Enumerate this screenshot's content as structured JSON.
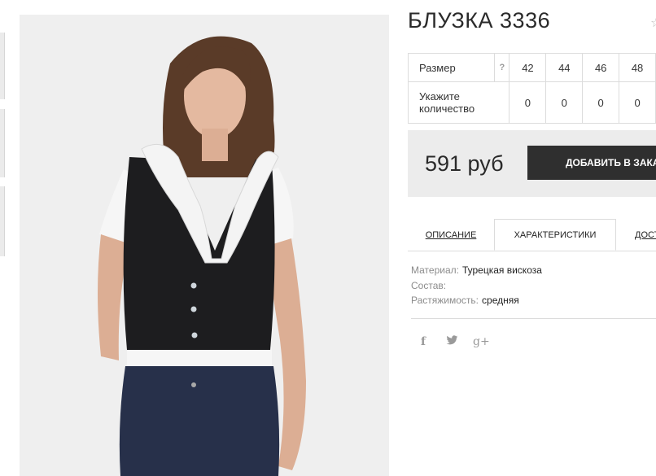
{
  "product": {
    "title": "БЛУЗКА 3336"
  },
  "sizes": {
    "row_label": "Размер",
    "help": "?",
    "values": [
      "42",
      "44",
      "46",
      "48"
    ],
    "qty_label": "Укажите количество",
    "quantities": [
      "0",
      "0",
      "0",
      "0"
    ]
  },
  "price": {
    "amount": "591 руб",
    "cart_label": "ДОБАВИТЬ В ЗАКАЗ"
  },
  "tabs": [
    {
      "label": "ОПИСАНИЕ"
    },
    {
      "label": "ХАРАКТЕРИСТИКИ"
    },
    {
      "label": "ДОСТАВКА"
    }
  ],
  "characteristics": [
    {
      "key": "Материал:",
      "value": "Турецкая вискоза"
    },
    {
      "key": "Состав:",
      "value": ""
    },
    {
      "key": "Растяжимость:",
      "value": "средняя"
    }
  ],
  "social": {
    "facebook": "f",
    "twitter": "🐦",
    "googleplus": "g+"
  },
  "icons": [
    "star-icon",
    "shopping-bag-icon",
    "facebook-icon",
    "twitter-icon",
    "google-plus-icon"
  ],
  "colors": {
    "button_bg": "#2f2f2f",
    "price_box_bg": "#ececec",
    "border": "#dcdcdc"
  }
}
